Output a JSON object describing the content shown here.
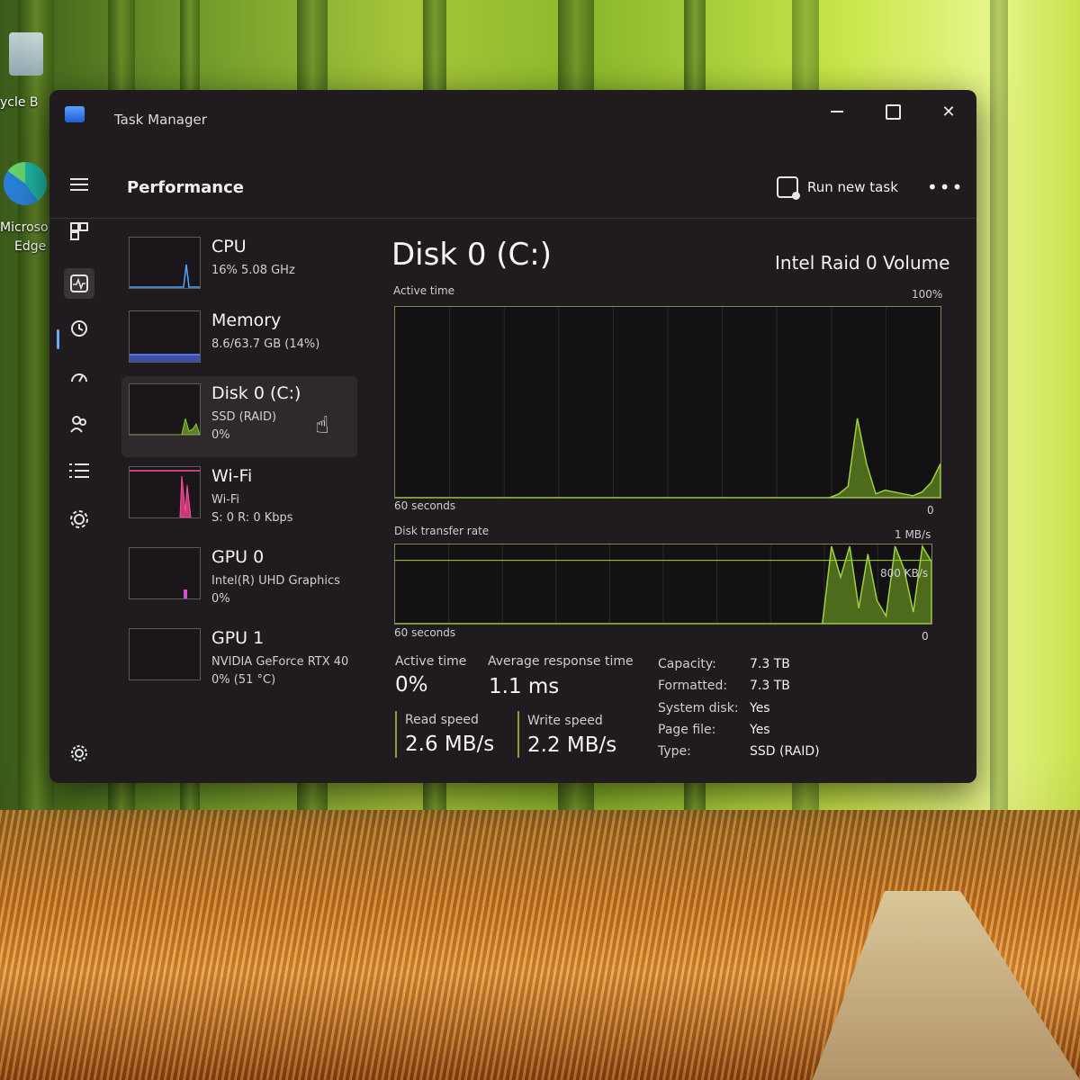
{
  "desktop": {
    "recycle_label": "ycle B",
    "edge_label_1": "Microso",
    "edge_label_2": "Edge"
  },
  "window": {
    "title": "Task Manager",
    "controls": {
      "minimize": "–",
      "maximize": "□",
      "close": "✕"
    }
  },
  "header": {
    "page_title": "Performance",
    "run_new_task": "Run new task",
    "more": "•••"
  },
  "rail": {
    "items": [
      "hamburger-icon",
      "processes-icon",
      "performance-icon",
      "app-history-icon",
      "startup-apps-icon",
      "users-icon",
      "details-icon",
      "services-icon"
    ],
    "settings": "settings-icon",
    "active": "performance-icon"
  },
  "devices": [
    {
      "name": "CPU",
      "sub": "16%  5.08 GHz",
      "sub2": "",
      "color": "#4ea6ff"
    },
    {
      "name": "Memory",
      "sub": "8.6/63.7 GB (14%)",
      "sub2": "",
      "color": "#6a8bff"
    },
    {
      "name": "Disk 0 (C:)",
      "sub": "SSD (RAID)",
      "sub2": "0%",
      "color": "#8cc63a",
      "selected": true
    },
    {
      "name": "Wi-Fi",
      "sub": "Wi-Fi",
      "sub2": "S: 0  R: 0 Kbps",
      "color": "#ff4d9a"
    },
    {
      "name": "GPU 0",
      "sub": "Intel(R) UHD Graphics",
      "sub2": "0%",
      "color": "#d64fd8"
    },
    {
      "name": "GPU 1",
      "sub": "NVIDIA GeForce RTX 40",
      "sub2": "0%  (51 °C)",
      "color": "#d64fd8"
    }
  ],
  "detail": {
    "title": "Disk 0 (C:)",
    "model": "Intel Raid 0 Volume",
    "graph1": {
      "label": "Active time",
      "max": "100%",
      "span": "60 seconds",
      "min": "0",
      "series_percent": [
        0,
        0,
        0,
        0,
        0,
        0,
        0,
        0,
        0,
        0,
        0,
        0,
        0,
        0,
        0,
        0,
        0,
        0,
        0,
        0,
        0,
        0,
        0,
        0,
        0,
        0,
        0,
        0,
        0,
        0,
        0,
        0,
        0,
        0,
        0,
        0,
        0,
        0,
        0,
        0,
        0,
        0,
        0,
        0,
        0,
        0,
        0,
        0,
        2,
        6,
        42,
        18,
        2,
        4,
        3,
        2,
        1,
        3,
        8,
        18
      ]
    },
    "graph2": {
      "label": "Disk transfer rate",
      "max": "1 MB/s",
      "mid": "800 KB/s",
      "span": "60 seconds",
      "min": "0",
      "series_percent": [
        0,
        0,
        0,
        0,
        0,
        0,
        0,
        0,
        0,
        0,
        0,
        0,
        0,
        0,
        0,
        0,
        0,
        0,
        0,
        0,
        0,
        0,
        0,
        0,
        0,
        0,
        0,
        0,
        0,
        0,
        0,
        0,
        0,
        0,
        0,
        0,
        0,
        0,
        0,
        0,
        0,
        0,
        0,
        0,
        0,
        0,
        0,
        0,
        100,
        60,
        100,
        20,
        90,
        30,
        10,
        100,
        70,
        15,
        100,
        80
      ]
    },
    "stats": {
      "active_time_label": "Active time",
      "active_time": "0%",
      "avg_response_label": "Average response time",
      "avg_response": "1.1 ms",
      "read_label": "Read speed",
      "read": "2.6 MB/s",
      "write_label": "Write speed",
      "write": "2.2 MB/s"
    },
    "properties": [
      {
        "k": "Capacity:",
        "v": "7.3 TB"
      },
      {
        "k": "Formatted:",
        "v": "7.3 TB"
      },
      {
        "k": "System disk:",
        "v": "Yes"
      },
      {
        "k": "Page file:",
        "v": "Yes"
      },
      {
        "k": "Type:",
        "v": "SSD (RAID)"
      }
    ]
  }
}
